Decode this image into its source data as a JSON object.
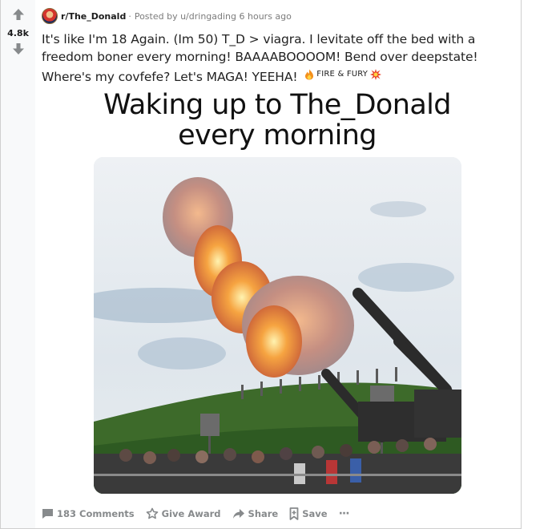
{
  "post": {
    "score": "4.8k",
    "subreddit": "r/The_Donald",
    "separator": "·",
    "posted_by": "Posted by u/dringading 6 hours ago",
    "title": "It's like I'm 18 Again. (Im 50) T_D > viagra. I levitate off the bed with a freedom boner every morning! BAAAABOOOOM! Bend over deepstate! Where's my covfefe? Let's MAGA! YEEHA!",
    "flair": "FIRE & FURY",
    "image_caption_line1": "Waking up to The_Donald",
    "image_caption_line2": "every morning"
  },
  "actions": {
    "comments": "183 Comments",
    "award": "Give Award",
    "share": "Share",
    "save": "Save",
    "more": "···"
  },
  "icons": {
    "upvote": "upvote-arrow-icon",
    "downvote": "downvote-arrow-icon",
    "comment": "comment-icon",
    "award": "award-icon",
    "share": "share-icon",
    "save": "save-icon",
    "more": "more-options-icon",
    "flair_fire": "fire-icon",
    "flair_explosion": "explosion-icon"
  },
  "colors": {
    "vote_bar_bg": "#f8f9fa",
    "arrow": "#878a8c",
    "meta_text": "#7c7c7c",
    "action_text": "#878a8c"
  }
}
